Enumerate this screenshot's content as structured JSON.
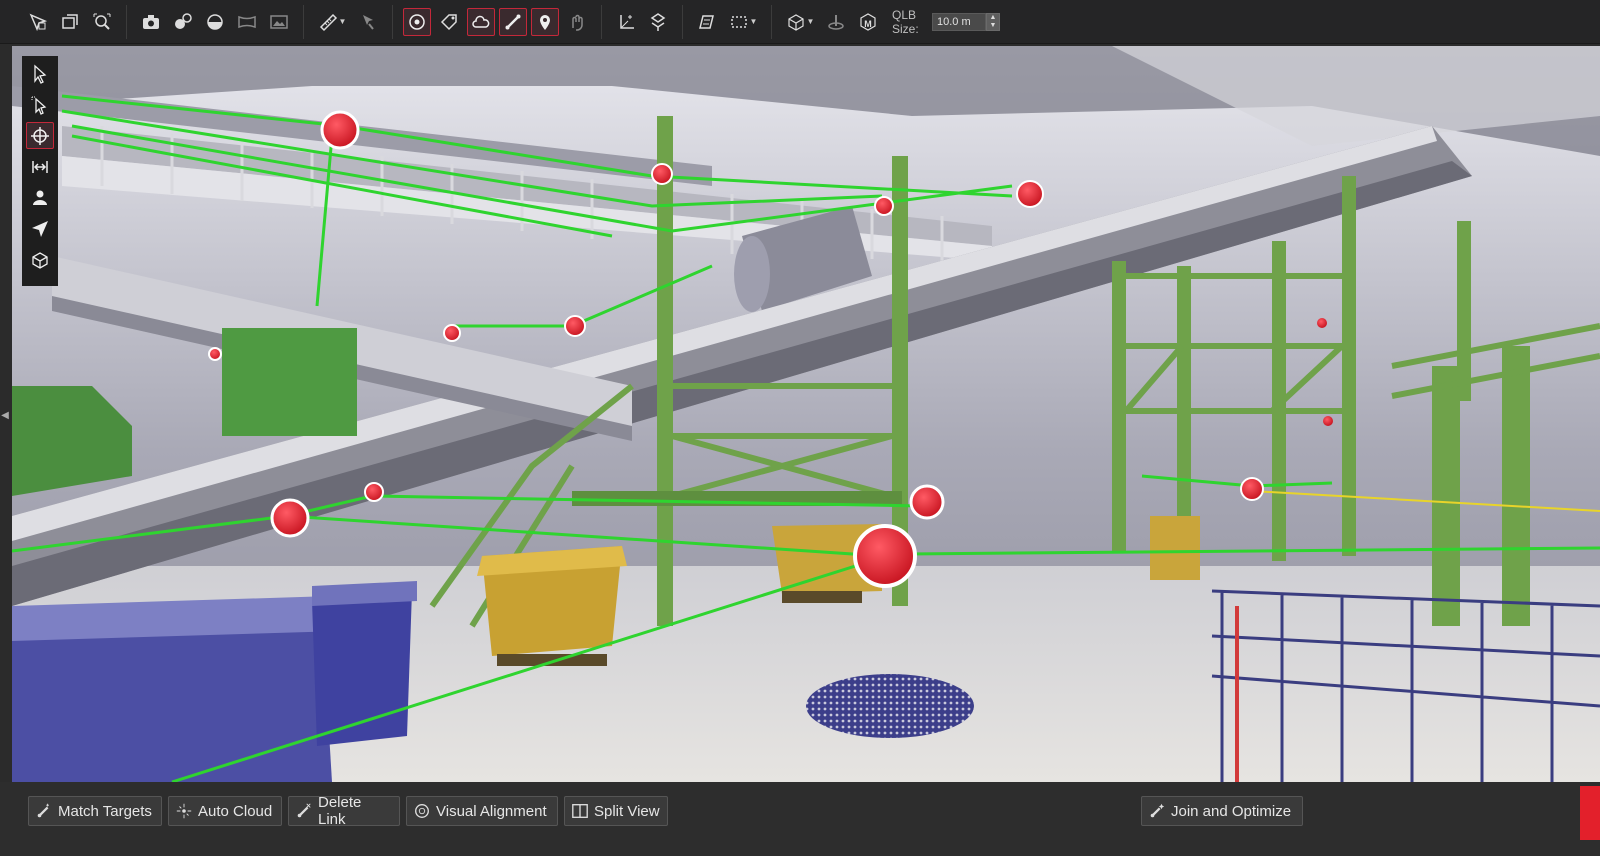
{
  "toolbar": {
    "groups": [
      [
        "select-by-region-icon",
        "window-icon",
        "zoom-fit-icon"
      ],
      [
        "camera-icon",
        "spheres-icon",
        "sphere-icon",
        "panorama-icon",
        "image-icon"
      ],
      [
        "ruler-icon",
        "probe-icon"
      ],
      [
        "target-icon",
        "tag-icon",
        "cloud-icon",
        "link-icon",
        "location-pin-icon",
        "gesture-icon"
      ],
      [
        "axes-icon",
        "transform-icon"
      ],
      [
        "texture-icon",
        "selection-box-icon"
      ],
      [
        "bounding-box-icon",
        "scan-icon",
        "mesh-icon"
      ]
    ],
    "active_buttons": [
      "target-icon",
      "cloud-icon",
      "link-icon",
      "location-pin-icon"
    ],
    "qlb_label": "QLB Size:",
    "qlb_value": "10.0 m"
  },
  "side_tools": [
    "select-arrow-icon",
    "select-region-icon",
    "orbit-icon",
    "pan-icon",
    "walk-icon",
    "navigate-icon",
    "view-cube-icon"
  ],
  "side_tools_active": "orbit-icon",
  "bottom": {
    "match_targets": "Match Targets",
    "auto_cloud": "Auto Cloud",
    "delete_link": "Delete Link",
    "visual_alignment": "Visual Alignment",
    "split_view": "Split View",
    "join_optimize": "Join and Optimize"
  },
  "colors": {
    "accent": "#c4283a",
    "link_line": "#2fd42f",
    "target": "#e01e2c",
    "steel_green": "#6fa24a"
  }
}
